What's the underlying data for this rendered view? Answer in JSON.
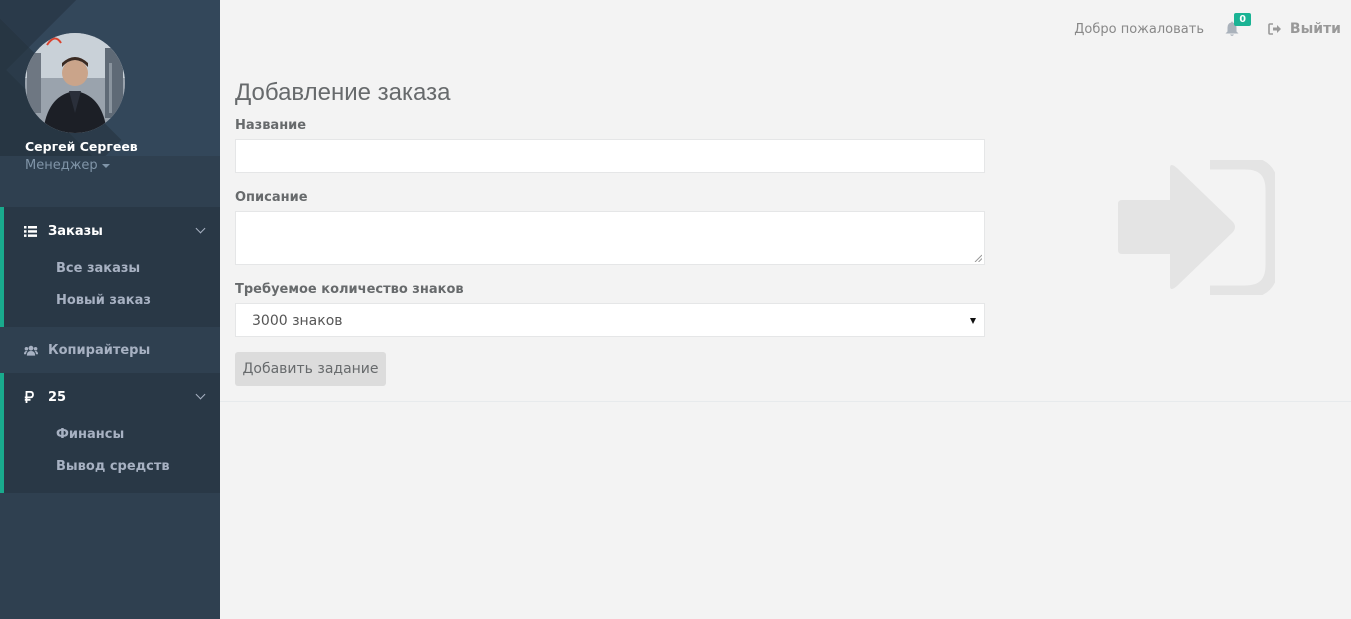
{
  "sidebar": {
    "user_name": "Сергей Сергеев",
    "user_role": "Менеджер",
    "groups": [
      {
        "label": "Заказы",
        "icon": "list-icon",
        "items": [
          "Все заказы",
          "Новый заказ"
        ]
      },
      {
        "label": "Копирайтеры",
        "icon": "users-icon"
      },
      {
        "label": "25",
        "icon": "ruble-icon",
        "items": [
          "Финансы",
          "Вывод средств"
        ]
      }
    ]
  },
  "topbar": {
    "welcome": "Добро пожаловать",
    "notifications_count": "0",
    "logout_label": "Выйти"
  },
  "main": {
    "title": "Добавление заказа",
    "fields": {
      "name_label": "Название",
      "name_value": "",
      "description_label": "Описание",
      "description_value": "",
      "chars_label": "Требуемое количество знаков",
      "chars_value": "3000 знаков"
    },
    "submit_label": "Добавить задание"
  },
  "colors": {
    "sidebar_bg": "#2f4050",
    "accent": "#19aa8d",
    "page_bg": "#f3f3f3"
  }
}
